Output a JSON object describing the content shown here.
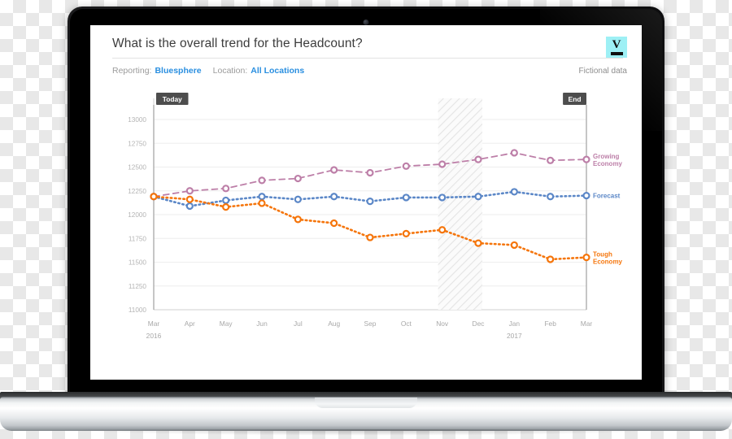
{
  "device": {
    "type": "laptop",
    "camera": "webcam-dot"
  },
  "header": {
    "title": "What is the overall trend for the Headcount?",
    "logo_letter": "V",
    "reporting_label": "Reporting:",
    "reporting_value": "Bluesphere",
    "location_label": "Location:",
    "location_value": "All Locations",
    "note": "Fictional data"
  },
  "markers": {
    "today": "Today",
    "end": "End"
  },
  "colors": {
    "growing": "#bd7fa8",
    "forecast": "#5b87c7",
    "tough": "#f5750b",
    "link": "#2a8fe0",
    "marker_badge": "#4d4d4d",
    "logo_bg": "#9ef0f5"
  },
  "chart_data": {
    "type": "line",
    "title": "What is the overall trend for the Headcount?",
    "xlabel": "",
    "ylabel": "",
    "ylim": [
      11000,
      13000
    ],
    "ytick_step": 250,
    "yticks": [
      13000,
      12750,
      12500,
      12250,
      12000,
      11750,
      11500,
      11250,
      11000
    ],
    "categories": [
      "Mar",
      "Apr",
      "May",
      "Jun",
      "Jul",
      "Aug",
      "Sep",
      "Oct",
      "Nov",
      "Dec",
      "Jan",
      "Feb",
      "Mar"
    ],
    "year_labels": [
      {
        "index": 0,
        "label": "2016"
      },
      {
        "index": 10,
        "label": "2017"
      }
    ],
    "grid": true,
    "legend": "inline-right",
    "annotations": [
      {
        "name": "today-marker",
        "label": "Today",
        "x_index": 0
      },
      {
        "name": "end-marker",
        "label": "End",
        "x_index": 12
      },
      {
        "name": "hatched-band",
        "from_index": 8,
        "to_index": 9
      }
    ],
    "series": [
      {
        "name": "Growing Economy",
        "label": "Growing\nEconomy",
        "label_line1": "Growing",
        "label_line2": "Economy",
        "color": "#bd7fa8",
        "style": "dashed",
        "values": [
          12190,
          12250,
          12275,
          12360,
          12380,
          12470,
          12440,
          12510,
          12530,
          12580,
          12650,
          12570,
          12580
        ]
      },
      {
        "name": "Forecast",
        "label": "Forecast",
        "label_line1": "Forecast",
        "color": "#5b87c7",
        "style": "dotted",
        "values": [
          12190,
          12090,
          12150,
          12190,
          12160,
          12190,
          12140,
          12180,
          12180,
          12190,
          12240,
          12190,
          12200
        ]
      },
      {
        "name": "Tough Economy",
        "label": "Tough\nEconomy",
        "label_line1": "Tough",
        "label_line2": "Economy",
        "color": "#f5750b",
        "style": "dotted",
        "values": [
          12190,
          12160,
          12080,
          12120,
          11950,
          11910,
          11760,
          11800,
          11840,
          11700,
          11680,
          11530,
          11550
        ]
      }
    ]
  }
}
